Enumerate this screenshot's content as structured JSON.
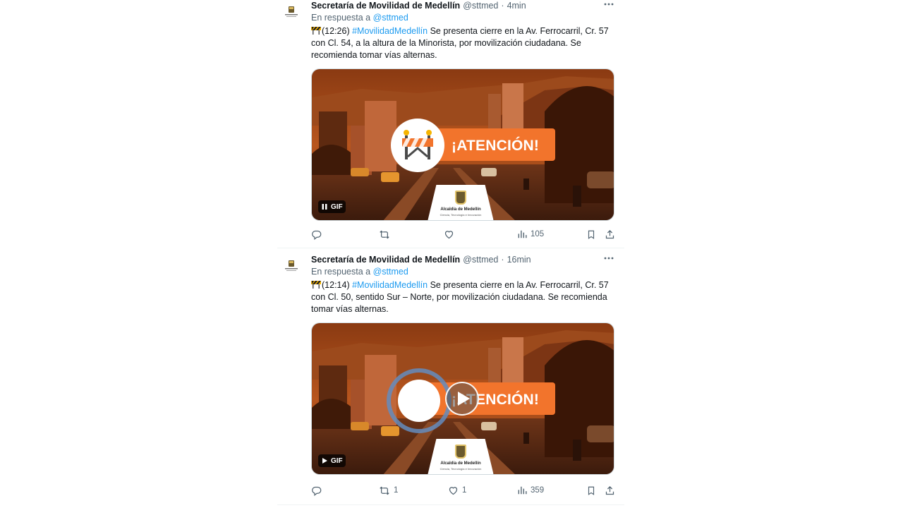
{
  "tweets": [
    {
      "author_name": "Secretaría de Movilidad de Medellín",
      "handle": "@sttmed",
      "separator": "·",
      "time": "4min",
      "reply_prefix": "En respuesta a",
      "reply_to": "@sttmed",
      "text_time": "(12:26)",
      "hashtag": "#MovilidadMedellín",
      "text_body": " Se presenta cierre en la Av. Ferrocarril, Cr. 57 con Cl. 54, a la altura de la Minorista, por movilización ciudadana. Se recomienda tomar vías alternas.",
      "media": {
        "headline": "¡ATENCIÓN!",
        "badge": "GIF",
        "badge_icon": "pause-icon",
        "logo_line1": "Alcaldía de Medellín",
        "logo_line2": "Ciencia, Tecnología e Innovación"
      },
      "actions": {
        "reply": "",
        "retweet": "",
        "like": "",
        "views": "105"
      }
    },
    {
      "author_name": "Secretaría de Movilidad de Medellín",
      "handle": "@sttmed",
      "separator": "·",
      "time": "16min",
      "reply_prefix": "En respuesta a",
      "reply_to": "@sttmed",
      "text_time": "(12:14)",
      "hashtag": "#MovilidadMedellín",
      "text_body": " Se presenta cierre en la Av. Ferrocarril, Cr. 57 con Cl. 50, sentido Sur – Norte, por movilización ciudadana. Se recomienda tomar vías alternas.",
      "media": {
        "headline": "¡ATENCIÓN!",
        "badge": "GIF",
        "badge_icon": "play-icon",
        "logo_line1": "Alcaldía de Medellín",
        "logo_line2": "Ciencia, Tecnología e Innovación"
      },
      "actions": {
        "reply": "",
        "retweet": "1",
        "like": "1",
        "views": "359"
      }
    }
  ],
  "colors": {
    "link": "#1d9bf0",
    "muted": "#536471",
    "accent_orange": "#f2742c"
  }
}
